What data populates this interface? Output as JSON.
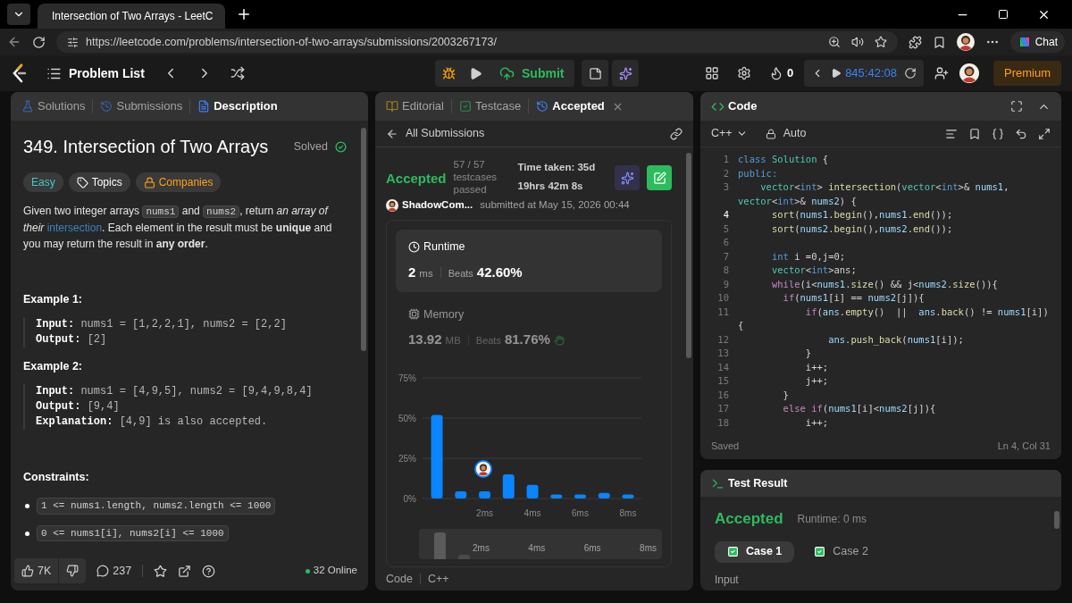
{
  "browser": {
    "tab_title": "Intersection of Two Arrays - LeetC",
    "url": "https://leetcode.com/problems/intersection-of-two-arrays/submissions/2003267173/",
    "chat": "Chat"
  },
  "nav": {
    "problem_list": "Problem List",
    "submit": "Submit",
    "streak": "0",
    "timer": "845:42:08",
    "premium": "Premium"
  },
  "description_panel": {
    "tabs": [
      {
        "label": "Solutions",
        "kind": "solutions",
        "selected": false
      },
      {
        "label": "Submissions",
        "kind": "submissions",
        "selected": false
      },
      {
        "label": "Description",
        "kind": "description",
        "selected": true
      }
    ],
    "title": "349. Intersection of Two Arrays",
    "status": "Solved",
    "tags": [
      {
        "label": "Easy",
        "kind": "difficulty"
      },
      {
        "label": "Topics",
        "kind": "topics"
      },
      {
        "label": "Companies",
        "kind": "companies"
      }
    ],
    "paragraph": [
      {
        "kind": "text",
        "text": "Given two integer arrays "
      },
      {
        "kind": "code",
        "text": "nums1"
      },
      {
        "kind": "text",
        "text": " and "
      },
      {
        "kind": "code",
        "text": "nums2"
      },
      {
        "kind": "text",
        "text": ", return *an array of their* "
      },
      {
        "kind": "link",
        "text": "intersection"
      },
      {
        "kind": "text",
        "text": ". Each element in the result must be **unique** and you may return the result in **any order**."
      }
    ],
    "examples": [
      {
        "title": "Example 1:",
        "lines": [
          {
            "label": "Input:",
            "value": "nums1 = [1,2,2,1], nums2 = [2,2]"
          },
          {
            "label": "Output:",
            "value": "[2]"
          }
        ]
      },
      {
        "title": "Example 2:",
        "lines": [
          {
            "label": "Input:",
            "value": "nums1 = [4,9,5], nums2 = [9,4,9,8,4]"
          },
          {
            "label": "Output:",
            "value": "[9,4]"
          },
          {
            "label": "Explanation:",
            "value": "[4,9] is also accepted."
          }
        ]
      }
    ],
    "constraints_title": "Constraints:",
    "constraints": [
      "1 <= nums1.length, nums2.length <= 1000",
      "0 <= nums1[i], nums2[i] <= 1000"
    ],
    "footer": {
      "likes": "7K",
      "comments": "237",
      "online": "32 Online"
    }
  },
  "submission_panel": {
    "tabs": [
      {
        "label": "Editorial",
        "kind": "editorial",
        "selected": false
      },
      {
        "label": "Testcase",
        "kind": "testcase",
        "selected": false
      },
      {
        "label": "Accepted",
        "kind": "result",
        "selected": true
      }
    ],
    "back_link": "All Submissions",
    "status": "Accepted",
    "passed": "57 / 57 testcases passed",
    "time_taken": "Time taken: 35d 19hrs 42m 8s",
    "user": "ShadowCom...",
    "submitted": "submitted at May 15, 2026 00:44",
    "metrics": [
      {
        "kind": "runtime",
        "label": "Runtime",
        "value": "2",
        "unit": "ms",
        "beats_label": "Beats",
        "beats": "42.60%",
        "selected": true
      },
      {
        "kind": "memory",
        "label": "Memory",
        "value": "13.92",
        "unit": "MB",
        "beats_label": "Beats",
        "beats": "81.76%",
        "selected": false
      }
    ],
    "chart_data": {
      "type": "bar",
      "x": [
        0,
        1,
        2,
        3,
        4,
        5,
        6,
        7,
        8
      ],
      "values": [
        52,
        4.5,
        4.5,
        15,
        8.5,
        2.5,
        2.5,
        3.5,
        2.5
      ],
      "xlim": [
        -0.6,
        8.56
      ],
      "ylim": [
        0,
        75
      ],
      "yticks": [
        {
          "value": 0,
          "label": "0%"
        },
        {
          "value": 25,
          "label": "25%"
        },
        {
          "value": 50,
          "label": "50%"
        },
        {
          "value": 75,
          "label": "75%"
        }
      ],
      "xticks": [
        {
          "value": 2,
          "label": "2ms"
        },
        {
          "value": 4,
          "label": "4ms"
        },
        {
          "value": 6,
          "label": "6ms"
        },
        {
          "value": 8,
          "label": "8ms"
        }
      ]
    },
    "overview_labels": [
      "2ms",
      "4ms",
      "6ms",
      "8ms"
    ],
    "footer": [
      "Code",
      "C++"
    ]
  },
  "code_panel": {
    "title": "Code",
    "language": "C++",
    "mode": "Auto",
    "status": "Saved",
    "cursor": "Ln 4, Col 31",
    "lines": [
      {
        "number": "1",
        "current": false,
        "segments": [
          {
            "text": "class ",
            "kind": "keyword"
          },
          {
            "text": "Solution",
            "kind": "type"
          },
          {
            "text": " {",
            "kind": "plain"
          }
        ]
      },
      {
        "number": "2",
        "current": false,
        "segments": [
          {
            "text": "public:",
            "kind": "keyword"
          }
        ]
      },
      {
        "number": "3",
        "current": false,
        "segments": [
          {
            "text": "    vector",
            "kind": "type"
          },
          {
            "text": "<",
            "kind": "plain"
          },
          {
            "text": "int",
            "kind": "keyword"
          },
          {
            "text": "> ",
            "kind": "plain"
          },
          {
            "text": "intersection",
            "kind": "function"
          },
          {
            "text": "(",
            "kind": "plain"
          },
          {
            "text": "vector",
            "kind": "type"
          },
          {
            "text": "<",
            "kind": "plain"
          },
          {
            "text": "int",
            "kind": "keyword"
          },
          {
            "text": ">& ",
            "kind": "plain"
          },
          {
            "text": "nums1",
            "kind": "variable"
          },
          {
            "text": ",",
            "kind": "plain"
          }
        ],
        "continuation": [
          {
            "text": "vector",
            "kind": "type"
          },
          {
            "text": "<",
            "kind": "plain"
          },
          {
            "text": "int",
            "kind": "keyword"
          },
          {
            "text": ">& ",
            "kind": "plain"
          },
          {
            "text": "nums2",
            "kind": "variable"
          },
          {
            "text": ") {",
            "kind": "plain"
          }
        ]
      },
      {
        "number": "4",
        "current": true,
        "segments": [
          {
            "text": "      sort",
            "kind": "function"
          },
          {
            "text": "(",
            "kind": "plain"
          },
          {
            "text": "nums1",
            "kind": "variable"
          },
          {
            "text": ".",
            "kind": "plain"
          },
          {
            "text": "begin",
            "kind": "function"
          },
          {
            "text": "(),",
            "kind": "plain"
          },
          {
            "text": "nums1",
            "kind": "variable"
          },
          {
            "text": ".",
            "kind": "plain"
          },
          {
            "text": "end",
            "kind": "function"
          },
          {
            "text": "());",
            "kind": "plain"
          }
        ]
      },
      {
        "number": "5",
        "current": false,
        "segments": [
          {
            "text": "      sort",
            "kind": "function"
          },
          {
            "text": "(",
            "kind": "plain"
          },
          {
            "text": "nums2",
            "kind": "variable"
          },
          {
            "text": ".",
            "kind": "plain"
          },
          {
            "text": "begin",
            "kind": "function"
          },
          {
            "text": "(),",
            "kind": "plain"
          },
          {
            "text": "nums2",
            "kind": "variable"
          },
          {
            "text": ".",
            "kind": "plain"
          },
          {
            "text": "end",
            "kind": "function"
          },
          {
            "text": "());",
            "kind": "plain"
          }
        ]
      },
      {
        "number": "6",
        "current": false
      },
      {
        "number": "7",
        "current": false,
        "segments": [
          {
            "text": "      int",
            "kind": "keyword"
          },
          {
            "text": " i =0,j=0;",
            "kind": "plain"
          }
        ]
      },
      {
        "number": "8",
        "current": false,
        "segments": [
          {
            "text": "      vector",
            "kind": "type"
          },
          {
            "text": "<",
            "kind": "plain"
          },
          {
            "text": "int",
            "kind": "keyword"
          },
          {
            "text": ">ans;",
            "kind": "plain"
          }
        ]
      },
      {
        "number": "9",
        "current": false,
        "segments": [
          {
            "text": "      while",
            "kind": "control"
          },
          {
            "text": "(i<",
            "kind": "plain"
          },
          {
            "text": "nums1",
            "kind": "variable"
          },
          {
            "text": ".",
            "kind": "plain"
          },
          {
            "text": "size",
            "kind": "function"
          },
          {
            "text": "() && j<",
            "kind": "plain"
          },
          {
            "text": "nums2",
            "kind": "variable"
          },
          {
            "text": ".",
            "kind": "plain"
          },
          {
            "text": "size",
            "kind": "function"
          },
          {
            "text": "()){",
            "kind": "plain"
          }
        ]
      },
      {
        "number": "10",
        "current": false,
        "segments": [
          {
            "text": "        if",
            "kind": "control"
          },
          {
            "text": "(",
            "kind": "plain"
          },
          {
            "text": "nums1",
            "kind": "variable"
          },
          {
            "text": "[i] == ",
            "kind": "plain"
          },
          {
            "text": "nums2",
            "kind": "variable"
          },
          {
            "text": "[j]){",
            "kind": "plain"
          }
        ]
      },
      {
        "number": "11",
        "current": false,
        "segments": [
          {
            "text": "            if",
            "kind": "control"
          },
          {
            "text": "(",
            "kind": "plain"
          },
          {
            "text": "ans",
            "kind": "variable"
          },
          {
            "text": ".",
            "kind": "plain"
          },
          {
            "text": "empty",
            "kind": "function"
          },
          {
            "text": "()  ||  ",
            "kind": "plain"
          },
          {
            "text": "ans",
            "kind": "variable"
          },
          {
            "text": ".",
            "kind": "plain"
          },
          {
            "text": "back",
            "kind": "function"
          },
          {
            "text": "() != ",
            "kind": "plain"
          },
          {
            "text": "nums1",
            "kind": "variable"
          },
          {
            "text": "[i])",
            "kind": "plain"
          }
        ],
        "continuation": [
          {
            "text": "{",
            "kind": "plain"
          }
        ]
      },
      {
        "number": "12",
        "current": false,
        "segments": [
          {
            "text": "                ans",
            "kind": "variable"
          },
          {
            "text": ".",
            "kind": "plain"
          },
          {
            "text": "push_back",
            "kind": "function"
          },
          {
            "text": "(",
            "kind": "plain"
          },
          {
            "text": "nums1",
            "kind": "variable"
          },
          {
            "text": "[i]);",
            "kind": "plain"
          }
        ]
      },
      {
        "number": "13",
        "current": false,
        "segments": [
          {
            "text": "            }",
            "kind": "plain"
          }
        ]
      },
      {
        "number": "14",
        "current": false,
        "segments": [
          {
            "text": "            i++;",
            "kind": "plain"
          }
        ]
      },
      {
        "number": "15",
        "current": false,
        "segments": [
          {
            "text": "            j++;",
            "kind": "plain"
          }
        ]
      },
      {
        "number": "16",
        "current": false,
        "segments": [
          {
            "text": "        }",
            "kind": "plain"
          }
        ]
      },
      {
        "number": "17",
        "current": false,
        "segments": [
          {
            "text": "        else if",
            "kind": "control"
          },
          {
            "text": "(",
            "kind": "plain"
          },
          {
            "text": "nums1",
            "kind": "variable"
          },
          {
            "text": "[i]<",
            "kind": "plain"
          },
          {
            "text": "nums2",
            "kind": "variable"
          },
          {
            "text": "[j]){",
            "kind": "plain"
          }
        ]
      },
      {
        "number": "18",
        "current": false,
        "segments": [
          {
            "text": "            i++;",
            "kind": "plain"
          }
        ]
      }
    ]
  },
  "test_result": {
    "title": "Test Result",
    "status": "Accepted",
    "runtime": "Runtime: 0 ms",
    "cases": [
      {
        "label": "Case 1",
        "selected": true,
        "passed": true
      },
      {
        "label": "Case 2",
        "selected": false,
        "passed": true
      }
    ],
    "input_label": "Input"
  }
}
